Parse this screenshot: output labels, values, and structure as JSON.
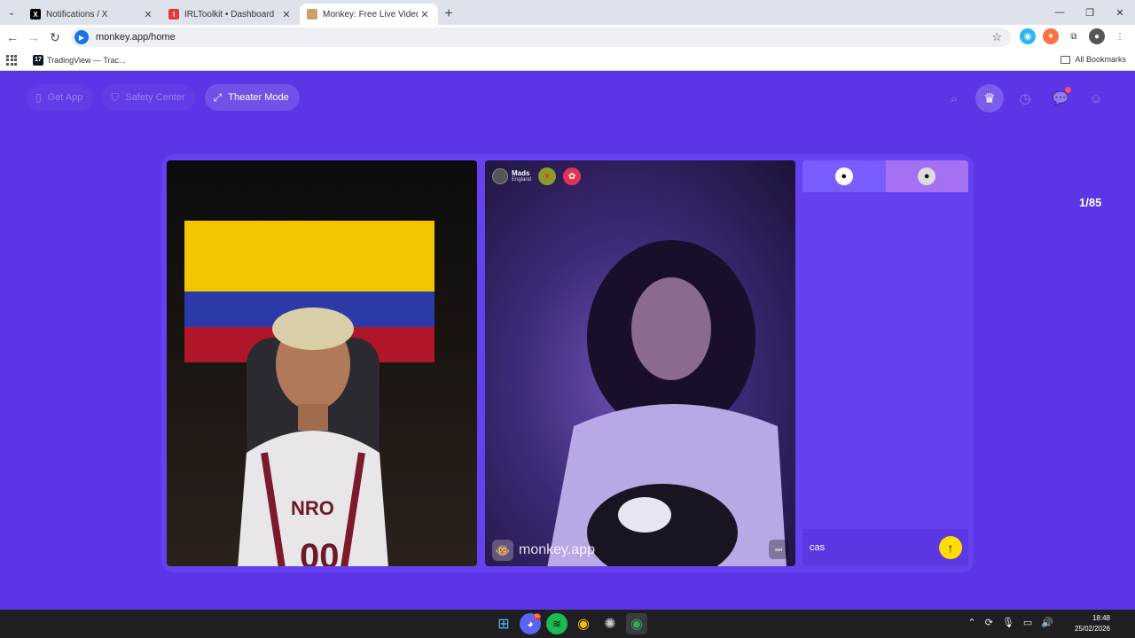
{
  "browser": {
    "tabs": [
      {
        "title": "Notifications / X",
        "favicon": "x-logo-icon",
        "active": false
      },
      {
        "title": "IRLToolkit • Dashboard",
        "favicon": "irltoolkit-icon",
        "active": false
      },
      {
        "title": "Monkey: Free Live Video Ch",
        "favicon": "monkey-icon",
        "active": true
      }
    ],
    "url": "monkey.app/home",
    "bookmarks": [
      {
        "title": "TradingView — Trac...",
        "favicon": "tradingview-icon"
      }
    ],
    "all_bookmarks_label": "All Bookmarks"
  },
  "monkey": {
    "nav": {
      "get_app": "Get App",
      "safety_center": "Safety Center",
      "theater_mode": "Theater Mode"
    },
    "counter": "1/85",
    "remote_user": {
      "name": "Mads",
      "country": "England"
    },
    "watermark": "monkey.app",
    "chat": {
      "input_value": "cas"
    }
  },
  "taskbar": {
    "time": "18:48",
    "date": "25/02/2026",
    "discord_badge": "9+"
  },
  "colors": {
    "page_bg": "#5b35e6",
    "accent_yellow": "#ffdd00",
    "chat_bg": "#6440ee"
  }
}
